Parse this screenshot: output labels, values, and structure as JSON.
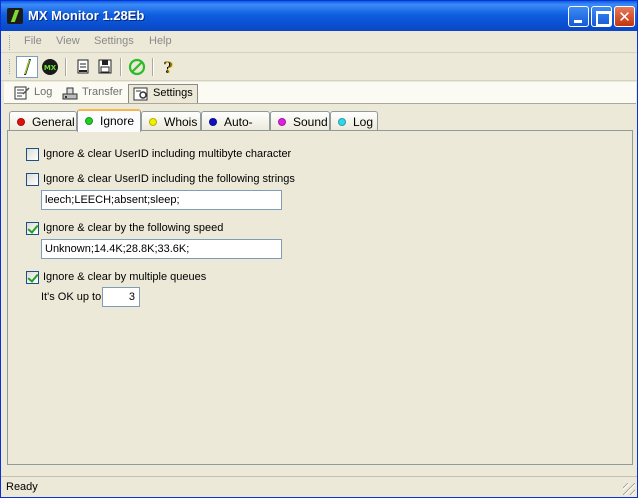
{
  "window": {
    "title": "MX Monitor 1.28Eb"
  },
  "menu": {
    "items": [
      "File",
      "View",
      "Settings",
      "Help"
    ]
  },
  "toolbar": {
    "buttons": [
      "start-icon",
      "mx-icon",
      "page-icon",
      "save-icon",
      "stop-icon",
      "help-icon"
    ]
  },
  "views": [
    {
      "label": "Log"
    },
    {
      "label": "Transfer"
    },
    {
      "label": "Settings"
    }
  ],
  "tabs": [
    {
      "label": "General",
      "color": "#e01010"
    },
    {
      "label": "Ignore",
      "color": "#22cc22"
    },
    {
      "label": "Whois",
      "color": "#f0f000"
    },
    {
      "label": "Auto-UL",
      "color": "#1010c0"
    },
    {
      "label": "Sound",
      "color": "#e020e0"
    },
    {
      "label": "Log",
      "color": "#30d8e8"
    }
  ],
  "ignore": {
    "multibyte": {
      "label": "Ignore & clear UserID including multibyte character",
      "checked": false
    },
    "strings": {
      "label": "Ignore & clear UserID including the following strings",
      "checked": false,
      "value": "leech;LEECH;absent;sleep;"
    },
    "speed": {
      "label": "Ignore & clear by the following speed",
      "checked": true,
      "value": "Unknown;14.4K;28.8K;33.6K;"
    },
    "queues": {
      "label": "Ignore & clear by multiple queues",
      "checked": true,
      "ok_label": "It's OK up to",
      "value": "3"
    }
  },
  "status": {
    "text": "Ready"
  }
}
